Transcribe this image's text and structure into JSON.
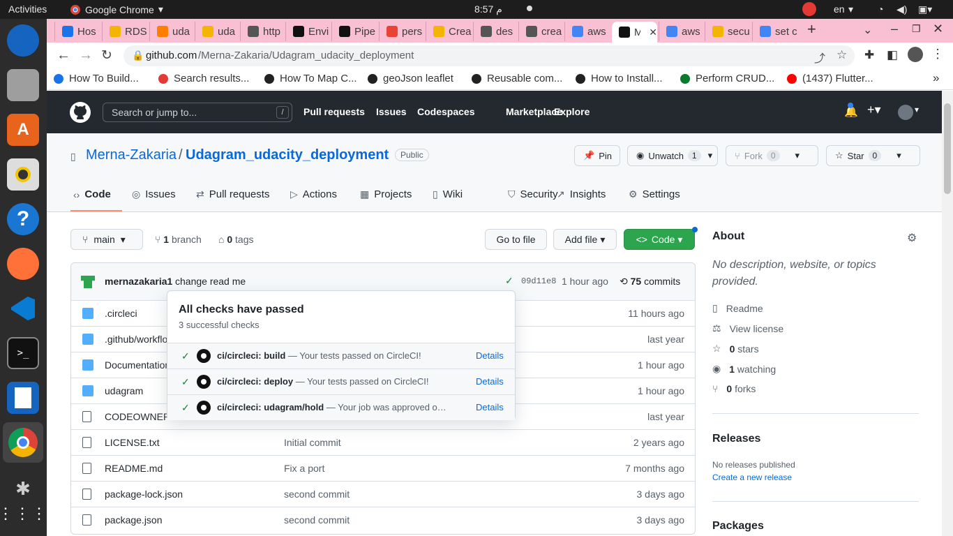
{
  "os": {
    "activities": "Activities",
    "app_name": "Google Chrome",
    "clock": "8:57 م",
    "language": "en"
  },
  "tabs": [
    {
      "label": "Hos",
      "color": "#1a73e8"
    },
    {
      "label": "RDS",
      "color": "#f5b400"
    },
    {
      "label": "uda",
      "color": "#ff7d00"
    },
    {
      "label": "uda",
      "color": "#f5b400"
    },
    {
      "label": "http",
      "color": "#555555"
    },
    {
      "label": "Envi",
      "color": "#111111"
    },
    {
      "label": "Pipe",
      "color": "#111111"
    },
    {
      "label": "pers",
      "color": "#ea4335"
    },
    {
      "label": "Crea",
      "color": "#f5b400"
    },
    {
      "label": "des",
      "color": "#555555"
    },
    {
      "label": "crea",
      "color": "#555555"
    },
    {
      "label": "aws",
      "color": "#4285f4"
    },
    {
      "label": "M",
      "color": "#111111"
    },
    {
      "label": "aws",
      "color": "#4285f4"
    },
    {
      "label": "secu",
      "color": "#f5b400"
    },
    {
      "label": "set c",
      "color": "#4285f4"
    }
  ],
  "url": {
    "domain": "github.com",
    "path": "/Merna-Zakaria/Udagram_udacity_deployment"
  },
  "bookmarks": [
    {
      "label": "How To Build...",
      "color": "#1a73e8"
    },
    {
      "label": "Search results...",
      "color": "#e53935"
    },
    {
      "label": "How To Map C...",
      "color": "#222222"
    },
    {
      "label": "geoJson leaflet",
      "color": "#222222"
    },
    {
      "label": "Reusable com...",
      "color": "#222222"
    },
    {
      "label": "How to Install...",
      "color": "#222222"
    },
    {
      "label": "Perform CRUD...",
      "color": "#0a7a2f"
    },
    {
      "label": "(1437) Flutter...",
      "color": "#ff0000"
    }
  ],
  "gh": {
    "search_placeholder": "Search or jump to...",
    "search_key": "/",
    "nav": [
      "Pull requests",
      "Issues",
      "Codespaces",
      "Marketplace",
      "Explore"
    ],
    "owner": "Merna-Zakaria",
    "sep": "/",
    "repo": "Udagram_udacity_deployment",
    "visibility": "Public",
    "pin": "Pin",
    "unwatch": "Unwatch",
    "unwatch_count": "1",
    "fork": "Fork",
    "fork_count": "0",
    "star": "Star",
    "star_count": "0",
    "repo_tabs": [
      "Code",
      "Issues",
      "Pull requests",
      "Actions",
      "Projects",
      "Wiki",
      "Security",
      "Insights",
      "Settings"
    ],
    "branch": "main",
    "branches_count": "1",
    "branches_label": "branch",
    "tags_count": "0",
    "tags_label": "tags",
    "go_to_file": "Go to file",
    "add_file": "Add file",
    "code_btn": "Code",
    "commit_author": "mernazakaria1",
    "commit_msg": "change read me",
    "commit_hash": "09d11e8",
    "commit_time": "1 hour ago",
    "commits_count": "75",
    "commits_label": "commits",
    "files": [
      {
        "name": ".circleci",
        "type": "dir",
        "msg": "",
        "time": "11 hours ago"
      },
      {
        "name": ".github/workflo",
        "type": "dir",
        "msg": "",
        "time": "last year"
      },
      {
        "name": "Documentation",
        "type": "dir",
        "msg": "",
        "time": "1 hour ago"
      },
      {
        "name": "udagram",
        "type": "dir",
        "msg": "",
        "time": "1 hour ago"
      },
      {
        "name": "CODEOWNER",
        "type": "file",
        "msg": "",
        "time": "last year"
      },
      {
        "name": "LICENSE.txt",
        "type": "file",
        "msg": "Initial commit",
        "time": "2 years ago"
      },
      {
        "name": "README.md",
        "type": "file",
        "msg": "Fix a port",
        "time": "7 months ago"
      },
      {
        "name": "package-lock.json",
        "type": "file",
        "msg": "second commit",
        "time": "3 days ago"
      },
      {
        "name": "package.json",
        "type": "file",
        "msg": "second commit",
        "time": "3 days ago"
      }
    ],
    "checks": {
      "title": "All checks have passed",
      "subtitle": "3 successful checks",
      "items": [
        {
          "name": "ci/circleci: build",
          "desc": "— Your tests passed on CircleCI!",
          "link": "Details"
        },
        {
          "name": "ci/circleci: deploy",
          "desc": "— Your tests passed on CircleCI!",
          "link": "Details"
        },
        {
          "name": "ci/circleci: udagram/hold",
          "desc": "— Your job was approved o…",
          "link": "Details"
        }
      ]
    },
    "about": {
      "title": "About",
      "desc": "No description, website, or topics provided.",
      "readme": "Readme",
      "license": "View license",
      "stars_count": "0",
      "stars_label": "stars",
      "watching_count": "1",
      "watching_label": "watching",
      "forks_count": "0",
      "forks_label": "forks",
      "releases_title": "Releases",
      "releases_none": "No releases published",
      "create_release": "Create a new release",
      "packages_title": "Packages"
    }
  },
  "colors": {
    "accent_link": "#0969da",
    "code_btn": "#2da44e",
    "tab_underline": "#fd8c73",
    "check": "#1a7f37"
  }
}
